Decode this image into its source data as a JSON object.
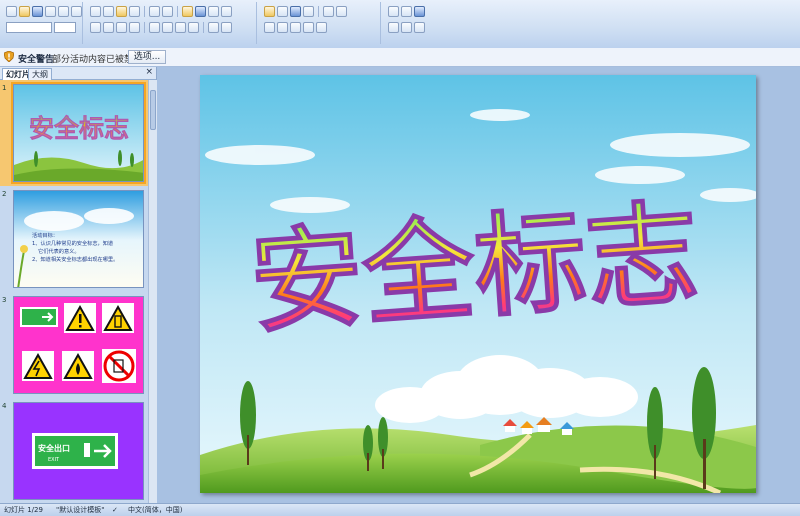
{
  "message_bar": {
    "title": "安全警告",
    "text": "部分活动内容已被禁用。",
    "options_button": "选项..."
  },
  "panel": {
    "tabs": [
      {
        "label": "幻灯片"
      },
      {
        "label": "大纲"
      }
    ],
    "close": "×"
  },
  "thumbnails": [
    {
      "number": "1",
      "title": "安全标志"
    },
    {
      "number": "2",
      "lines": [
        "活动目标：",
        "1、认识几种常见的安全标志，知道",
        "它们代表的意义。",
        "2、知道相关安全标志都出现在哪里。"
      ]
    },
    {
      "number": "3"
    },
    {
      "number": "4",
      "sign_text": "安全出口",
      "sign_sub": "EXIT"
    }
  ],
  "slide": {
    "title": "安全标志"
  },
  "status": {
    "slide_info": "幻灯片 1/29",
    "theme": "\"默认设计模板\"",
    "language": "中文(简体，中国)"
  },
  "colors": {
    "sky_top": "#5ec3e6",
    "sky_bottom": "#d9f1fa",
    "grass": "#8bc43f",
    "slide3_bg": "#ff33cc",
    "slide4_bg": "#9933ff",
    "exit_green": "#2eb24a",
    "selection": "#f6c770"
  }
}
